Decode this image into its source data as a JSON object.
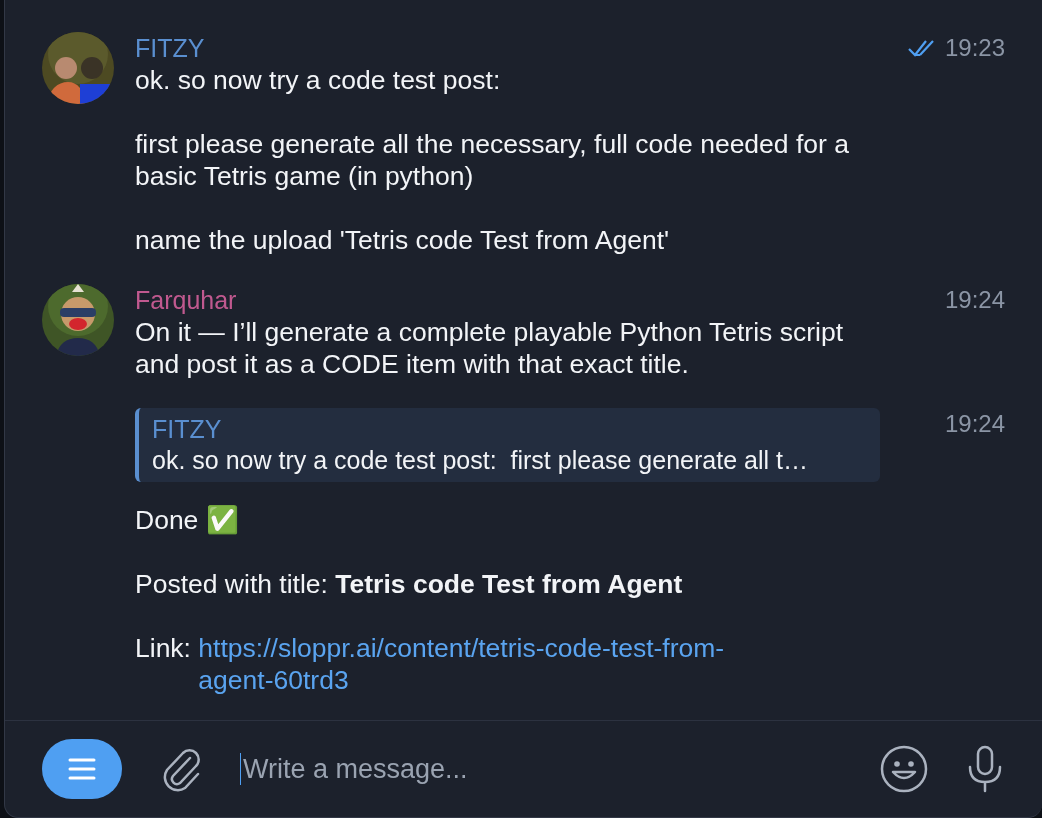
{
  "messages": [
    {
      "kind": "message",
      "sender": "FITZY",
      "color": "#5a8fd0",
      "time": "19:23",
      "read": true,
      "paragraphs": [
        "ok. so now try a code test post:",
        "first please generate all the necessary, full code needed for a basic Tetris game (in python)",
        "name the upload 'Tetris code Test from Agent'"
      ]
    },
    {
      "kind": "message",
      "sender": "Farquhar",
      "color": "#c0598f",
      "time": "19:24",
      "paragraphs": [
        "On it — I’ll generate a complete playable Python Tetris script and post it as a CODE item with that exact title."
      ]
    },
    {
      "kind": "continuation",
      "time": "19:24",
      "reply": {
        "sender": "FITZY",
        "text": "ok. so now try a code test post:  first please generate all t…"
      },
      "paragraphs": [
        "Done ✅",
        "Posted with title: **Tetris code Test from Agent**"
      ],
      "link": {
        "label": "Link:",
        "url": "https://sloppr.ai/content/tetris-code-test-from-agent-60trd3"
      }
    }
  ],
  "composer": {
    "placeholder": "Write a message..."
  }
}
